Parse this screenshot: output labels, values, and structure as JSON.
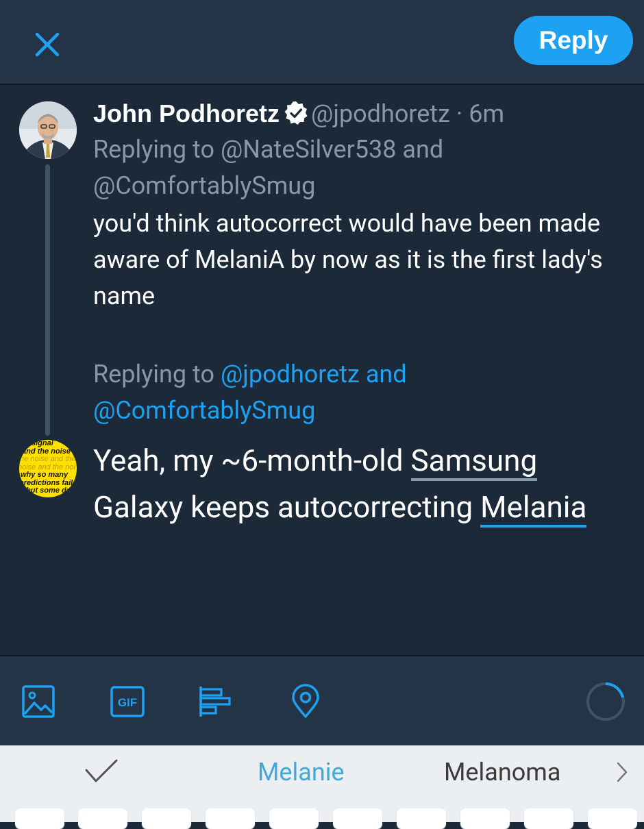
{
  "topbar": {
    "close_icon": "close-icon",
    "reply_label": "Reply",
    "accent_color": "#1da1f2"
  },
  "original_tweet": {
    "author_name": "John Podhoretz",
    "verified_icon": "verified-badge-icon",
    "handle": "@jpodhoretz",
    "separator": "·",
    "time": "6m",
    "replying_prefix": "Replying to",
    "replying_to": "@NateSilver538 and @ComfortablySmug",
    "body": "you'd think autocorrect would have been made aware of MelaniA by now as it is the first lady's name"
  },
  "reply_context": {
    "prefix": "Replying to",
    "mentions": "@jpodhoretz and @ComfortablySmug"
  },
  "compose": {
    "text_before": "Yeah, my ~6-month-old ",
    "word_samsung": "Samsung",
    "text_middle": " Galaxy keeps autocorrecting ",
    "word_melania": "Melania"
  },
  "avatar2": {
    "lines": [
      "signal",
      "and the noise",
      "the noise and the",
      "noise and the noi",
      "why so many",
      "predictions fail",
      "but some don't"
    ]
  },
  "toolbar": {
    "icons": [
      "image-icon",
      "gif-icon",
      "poll-icon",
      "location-icon"
    ],
    "gif_label": "GIF"
  },
  "keyboard": {
    "suggestions": [
      "Melanie",
      "Melanoma"
    ],
    "accept_icon": "checkmark-icon",
    "more_icon": "chevron-right-icon"
  }
}
